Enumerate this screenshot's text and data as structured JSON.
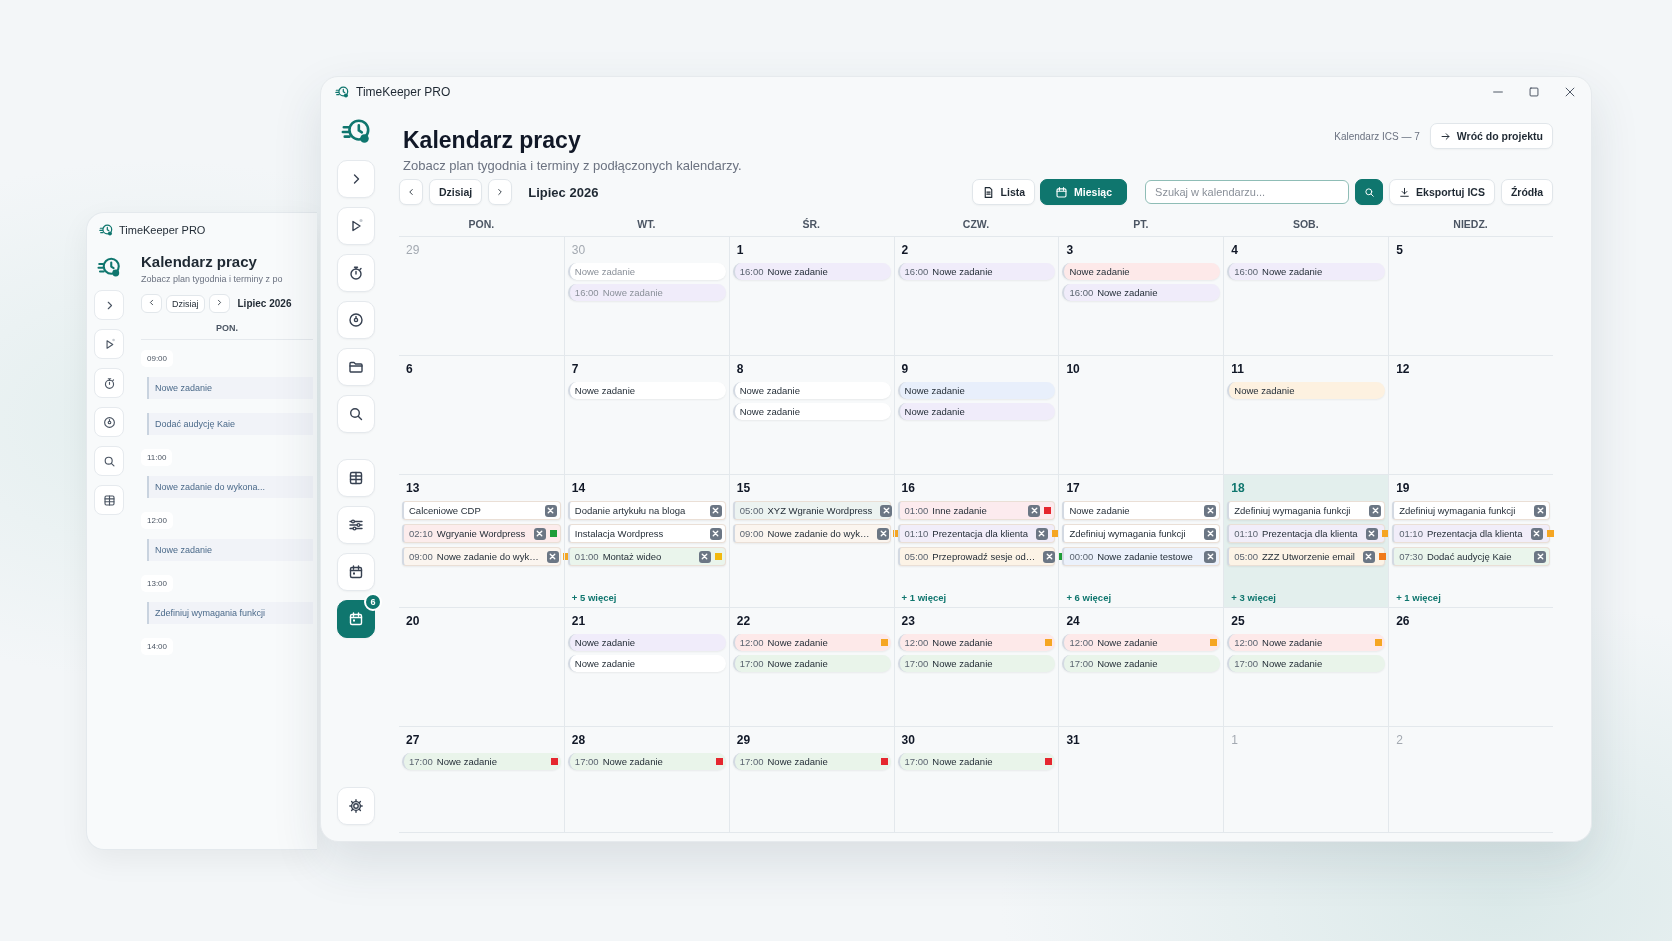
{
  "back_window": {
    "title": "TimeKeeper PRO",
    "sidebar": [
      {
        "kind": "logo"
      },
      {
        "kind": "expand"
      },
      {
        "kind": "play"
      },
      {
        "kind": "timer"
      },
      {
        "kind": "clock"
      },
      {
        "kind": "search"
      },
      {
        "kind": "table"
      }
    ],
    "heading": "Kalendarz pracy",
    "subtitle": "Zobacz plan tygodnia i terminy z po",
    "today": "Dzisiaj",
    "period": "Lipiec 2026",
    "weekday": "PON.",
    "slots": [
      {
        "time": "09:00",
        "events": [
          "Nowe zadanie",
          "Dodać audycję Kaie"
        ]
      },
      {
        "time": "11:00",
        "events": [
          "Nowe zadanie do wykona..."
        ]
      },
      {
        "time": "12:00",
        "events": [
          "Nowe zadanie"
        ]
      },
      {
        "time": "13:00",
        "events": [
          "Zdefiniuj wymagania funkcji"
        ]
      },
      {
        "time": "14:00"
      }
    ]
  },
  "window": {
    "title": "TimeKeeper PRO"
  },
  "sidebar": {
    "items": [
      {
        "kind": "expand",
        "selected": false
      },
      {
        "kind": "play",
        "selected": false
      },
      {
        "kind": "timer",
        "selected": false
      },
      {
        "kind": "clock",
        "selected": false
      },
      {
        "kind": "folder",
        "selected": false
      },
      {
        "kind": "search",
        "selected": false
      },
      {
        "kind": "table",
        "selected": false
      },
      {
        "kind": "sliders",
        "selected": false
      },
      {
        "kind": "calendar",
        "selected": false
      },
      {
        "kind": "calendar",
        "selected": true,
        "badge": "6"
      }
    ],
    "footer": {
      "kind": "settings",
      "selected": false
    }
  },
  "header": {
    "title": "Kalendarz pracy",
    "subtitle": "Zobacz plan tygodnia i terminy z podłączonych kalendarzy.",
    "ics_label": "Kalendarz ICS — 7",
    "back_button": "Wróć do projektu"
  },
  "toolbar": {
    "today": "Dzisiaj",
    "period": "Lipiec 2026",
    "views": [
      {
        "kind": "list",
        "label": "Lista",
        "selected": false
      },
      {
        "kind": "month",
        "label": "Miesiąc",
        "selected": true
      }
    ],
    "search": {
      "placeholder": "Szukaj w kalendarzu..."
    },
    "export": "Eksportuj ICS",
    "sources": "Źródła"
  },
  "calendar": {
    "weekdays": [
      "PON.",
      "WT.",
      "ŚR.",
      "CZW.",
      "PT.",
      "SOB.",
      "NIEDZ."
    ],
    "weeks": [
      {
        "days": [
          {
            "day": "29",
            "muted": true,
            "today": false
          },
          {
            "day": "30",
            "muted": true,
            "today": false,
            "events": [
              {
                "kind": "note",
                "title": "Nowe zadanie",
                "color": "#ffffff"
              },
              {
                "kind": "note",
                "time": "16:00",
                "title": "Nowe zadanie",
                "color": "#f0ecfa"
              }
            ]
          },
          {
            "day": "1",
            "muted": false,
            "today": false,
            "events": [
              {
                "kind": "note",
                "time": "16:00",
                "title": "Nowe zadanie",
                "color": "#f0ecfa"
              }
            ]
          },
          {
            "day": "2",
            "muted": false,
            "today": false,
            "events": [
              {
                "kind": "note",
                "time": "16:00",
                "title": "Nowe zadanie",
                "color": "#f0ecfa"
              }
            ]
          },
          {
            "day": "3",
            "muted": false,
            "today": false,
            "events": [
              {
                "kind": "note",
                "title": "Nowe zadanie",
                "color": "#fde9e9"
              },
              {
                "kind": "note",
                "time": "16:00",
                "title": "Nowe zadanie",
                "color": "#f0ecfa"
              }
            ]
          },
          {
            "day": "4",
            "muted": false,
            "today": false,
            "events": [
              {
                "kind": "note",
                "time": "16:00",
                "title": "Nowe zadanie",
                "color": "#f0ecfa"
              }
            ]
          },
          {
            "day": "5",
            "muted": false,
            "today": false
          }
        ]
      },
      {
        "days": [
          {
            "day": "6",
            "muted": false,
            "today": false
          },
          {
            "day": "7",
            "muted": false,
            "today": false,
            "events": [
              {
                "kind": "note",
                "title": "Nowe zadanie",
                "color": "#ffffff"
              }
            ]
          },
          {
            "day": "8",
            "muted": false,
            "today": false,
            "events": [
              {
                "kind": "note",
                "title": "Nowe zadanie",
                "color": "#ffffff"
              },
              {
                "kind": "note",
                "title": "Nowe zadanie",
                "color": "#ffffff"
              }
            ]
          },
          {
            "day": "9",
            "muted": false,
            "today": false,
            "events": [
              {
                "kind": "note",
                "title": "Nowe zadanie",
                "color": "#e8effb"
              },
              {
                "kind": "note",
                "title": "Nowe zadanie",
                "color": "#f0ecfa"
              }
            ]
          },
          {
            "day": "10",
            "muted": false,
            "today": false
          },
          {
            "day": "11",
            "muted": false,
            "today": false,
            "events": [
              {
                "kind": "note",
                "title": "Nowe zadanie",
                "color": "#fdf1e0"
              }
            ]
          },
          {
            "day": "12",
            "muted": false,
            "today": false
          }
        ]
      },
      {
        "days": [
          {
            "day": "13",
            "muted": false,
            "today": false,
            "events": [
              {
                "kind": "task",
                "title": "Calceniowe CDP",
                "color": "#ffffff"
              },
              {
                "kind": "task",
                "time": "02:10",
                "title": "Wgryanie Wordpress",
                "color": "#fcecec",
                "marker": {
                  "color": "#1e9e3a"
                }
              },
              {
                "kind": "task",
                "time": "09:00",
                "title": "Nowe zadanie do wyk…",
                "color": "#fbf5ef",
                "marker": {
                  "color": "#f5a623"
                }
              }
            ]
          },
          {
            "day": "14",
            "muted": false,
            "today": false,
            "events": [
              {
                "kind": "task",
                "title": "Dodanie artykułu na bloga",
                "color": "#ffffff"
              },
              {
                "kind": "task",
                "title": "Instalacja Wordpress",
                "color": "#ffffff"
              },
              {
                "kind": "task",
                "time": "01:00",
                "title": "Montaż wideo",
                "color": "#eaf5ec",
                "marker": {
                  "color": "#f2b90f"
                }
              }
            ],
            "more": "+ 5 więcej"
          },
          {
            "day": "15",
            "muted": false,
            "today": false,
            "events": [
              {
                "kind": "task",
                "time": "05:00",
                "title": "XYZ Wgranie Wordpress",
                "color": "#ecf3f1"
              },
              {
                "kind": "task",
                "time": "09:00",
                "title": "Nowe zadanie do wyk…",
                "color": "#fbf5ef",
                "marker": {
                  "color": "#f5a623"
                }
              }
            ]
          },
          {
            "day": "16",
            "muted": false,
            "today": false,
            "events": [
              {
                "kind": "task",
                "time": "01:00",
                "title": "Inne zadanie",
                "color": "#fcebee",
                "marker": {
                  "color": "#e5262e"
                }
              },
              {
                "kind": "task",
                "time": "01:10",
                "title": "Prezentacja dla klienta",
                "color": "#f1edf9",
                "marker": {
                  "color": "#f5a623"
                }
              },
              {
                "kind": "task",
                "time": "05:00",
                "title": "Przeprowadź sesje od…",
                "color": "#fcf3e6",
                "marker": {
                  "color": "#1e9e3a"
                }
              }
            ],
            "more": "+ 1 więcej"
          },
          {
            "day": "17",
            "muted": false,
            "today": false,
            "events": [
              {
                "kind": "task",
                "title": "Nowe zadanie",
                "color": "#ffffff"
              },
              {
                "kind": "task",
                "title": "Zdefiniuj wymagania funkcji",
                "color": "#ffffff"
              },
              {
                "kind": "task",
                "time": "00:00",
                "title": "Nowe zadanie testowe",
                "color": "#ebf1fb"
              }
            ],
            "more": "+ 6 więcej"
          },
          {
            "day": "18",
            "muted": false,
            "today": true,
            "events": [
              {
                "kind": "task",
                "title": "Zdefiniuj wymagania funkcji",
                "color": "#ffffff"
              },
              {
                "kind": "task",
                "time": "01:10",
                "title": "Prezentacja dla klienta",
                "color": "#f1edf9",
                "marker": {
                  "color": "#f5a623"
                }
              },
              {
                "kind": "task",
                "time": "05:00",
                "title": "ZZZ Utworzenie email",
                "color": "#fcf3e6",
                "marker": {
                  "color": "#f07a1a"
                }
              }
            ],
            "more": "+ 3 więcej"
          },
          {
            "day": "19",
            "muted": false,
            "today": false,
            "events": [
              {
                "kind": "task",
                "title": "Zdefiniuj wymagania funkcji",
                "color": "#ffffff"
              },
              {
                "kind": "task",
                "time": "01:10",
                "title": "Prezentacja dla klienta",
                "color": "#f1edf9",
                "marker": {
                  "color": "#f5a623"
                }
              },
              {
                "kind": "task",
                "time": "07:30",
                "title": "Dodać audycję Kaie",
                "color": "#eaf5ec"
              }
            ],
            "more": "+ 1 więcej"
          }
        ]
      },
      {
        "days": [
          {
            "day": "20",
            "muted": false,
            "today": false
          },
          {
            "day": "21",
            "muted": false,
            "today": false,
            "events": [
              {
                "kind": "note",
                "title": "Nowe zadanie",
                "color": "#f0ecfa"
              },
              {
                "kind": "note",
                "title": "Nowe zadanie",
                "color": "#ffffff"
              }
            ]
          },
          {
            "day": "22",
            "muted": false,
            "today": false,
            "events": [
              {
                "kind": "note",
                "time": "12:00",
                "title": "Nowe zadanie",
                "color": "#fde9e9",
                "marker": {
                  "color": "#f5a623"
                }
              },
              {
                "kind": "note",
                "time": "17:00",
                "title": "Nowe zadanie",
                "color": "#e9f4ea"
              }
            ]
          },
          {
            "day": "23",
            "muted": false,
            "today": false,
            "events": [
              {
                "kind": "note",
                "time": "12:00",
                "title": "Nowe zadanie",
                "color": "#fde9e9",
                "marker": {
                  "color": "#f5a623"
                }
              },
              {
                "kind": "note",
                "time": "17:00",
                "title": "Nowe zadanie",
                "color": "#e9f4ea"
              }
            ]
          },
          {
            "day": "24",
            "muted": false,
            "today": false,
            "events": [
              {
                "kind": "note",
                "time": "12:00",
                "title": "Nowe zadanie",
                "color": "#fde9e9",
                "marker": {
                  "color": "#f5a623"
                }
              },
              {
                "kind": "note",
                "time": "17:00",
                "title": "Nowe zadanie",
                "color": "#e9f4ea"
              }
            ]
          },
          {
            "day": "25",
            "muted": false,
            "today": false,
            "events": [
              {
                "kind": "note",
                "time": "12:00",
                "title": "Nowe zadanie",
                "color": "#fde9e9",
                "marker": {
                  "color": "#f5a623"
                }
              },
              {
                "kind": "note",
                "time": "17:00",
                "title": "Nowe zadanie",
                "color": "#e9f4ea"
              }
            ]
          },
          {
            "day": "26",
            "muted": false,
            "today": false
          }
        ]
      },
      {
        "days": [
          {
            "day": "27",
            "muted": false,
            "today": false,
            "events": [
              {
                "kind": "note",
                "time": "17:00",
                "title": "Nowe zadanie",
                "color": "#e9f4ea",
                "marker": {
                  "color": "#e5262e"
                }
              }
            ]
          },
          {
            "day": "28",
            "muted": false,
            "today": false,
            "events": [
              {
                "kind": "note",
                "time": "17:00",
                "title": "Nowe zadanie",
                "color": "#e9f4ea",
                "marker": {
                  "color": "#e5262e"
                }
              }
            ]
          },
          {
            "day": "29",
            "muted": false,
            "today": false,
            "events": [
              {
                "kind": "note",
                "time": "17:00",
                "title": "Nowe zadanie",
                "color": "#e9f4ea",
                "marker": {
                  "color": "#e5262e"
                }
              }
            ]
          },
          {
            "day": "30",
            "muted": false,
            "today": false,
            "events": [
              {
                "kind": "note",
                "time": "17:00",
                "title": "Nowe zadanie",
                "color": "#e9f4ea",
                "marker": {
                  "color": "#e5262e"
                }
              }
            ]
          },
          {
            "day": "31",
            "muted": false,
            "today": false
          },
          {
            "day": "1",
            "muted": true,
            "today": false
          },
          {
            "day": "2",
            "muted": true,
            "today": false
          }
        ]
      }
    ]
  }
}
